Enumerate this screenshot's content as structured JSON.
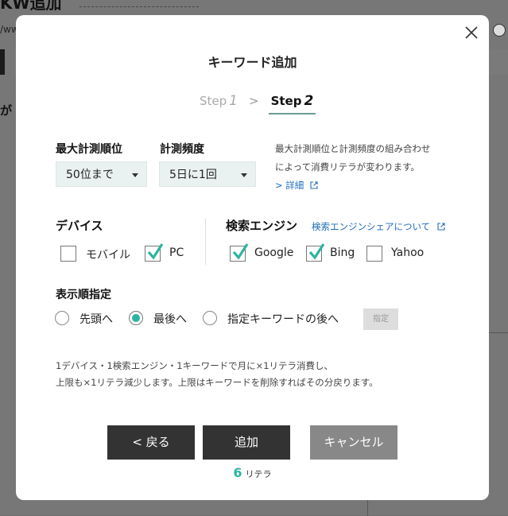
{
  "background": {
    "title": "KW追加",
    "url_fragment": "/ww",
    "heading_fragment": "が"
  },
  "modal": {
    "title": "キーワード追加",
    "steps": {
      "step1_label": "Step",
      "step1_num": "1",
      "separator": ">",
      "step2_label": "Step",
      "step2_num": "2"
    },
    "max_rank": {
      "label": "最大計測順位",
      "value": "50位まで"
    },
    "frequency": {
      "label": "計測頻度",
      "value": "5日に1回"
    },
    "note": {
      "line1": "最大計測順位と計測頻度の組み合わせ",
      "line2": "によって消費リテラが変わります。",
      "link": "> 詳細"
    },
    "device": {
      "label": "デバイス",
      "options": [
        {
          "label": "モバイル",
          "checked": false
        },
        {
          "label": "PC",
          "checked": true
        }
      ]
    },
    "engine": {
      "label": "検索エンジン",
      "share_link": "検索エンジンシェアについて",
      "options": [
        {
          "label": "Google",
          "checked": true
        },
        {
          "label": "Bing",
          "checked": true
        },
        {
          "label": "Yahoo",
          "checked": false
        }
      ]
    },
    "order": {
      "label": "表示順指定",
      "options": [
        {
          "label": "先頭へ",
          "selected": false
        },
        {
          "label": "最後へ",
          "selected": true
        },
        {
          "label": "指定キーワードの後へ",
          "selected": false
        }
      ],
      "specify_button": "指定"
    },
    "info": {
      "line1": "1デバイス・1検索エンジン・1キーワードで月に×1リテラ消費し、",
      "line2": "上限も×1リテラ減少します。上限はキーワードを削除すればその分戻ります。"
    },
    "buttons": {
      "back": "< 戻る",
      "add": "追加",
      "cancel": "キャンセル"
    },
    "credit": {
      "count": "6",
      "unit": "リテラ"
    }
  },
  "colors": {
    "accent": "#2bb5a0",
    "link": "#1f6db8",
    "dark_button": "#333333",
    "cancel_button": "#888888",
    "select_bg": "#eaf1f1"
  },
  "icons": {
    "close": "close-icon",
    "external": "external-link-icon",
    "check": "check-icon",
    "caret": "caret-down-icon"
  }
}
